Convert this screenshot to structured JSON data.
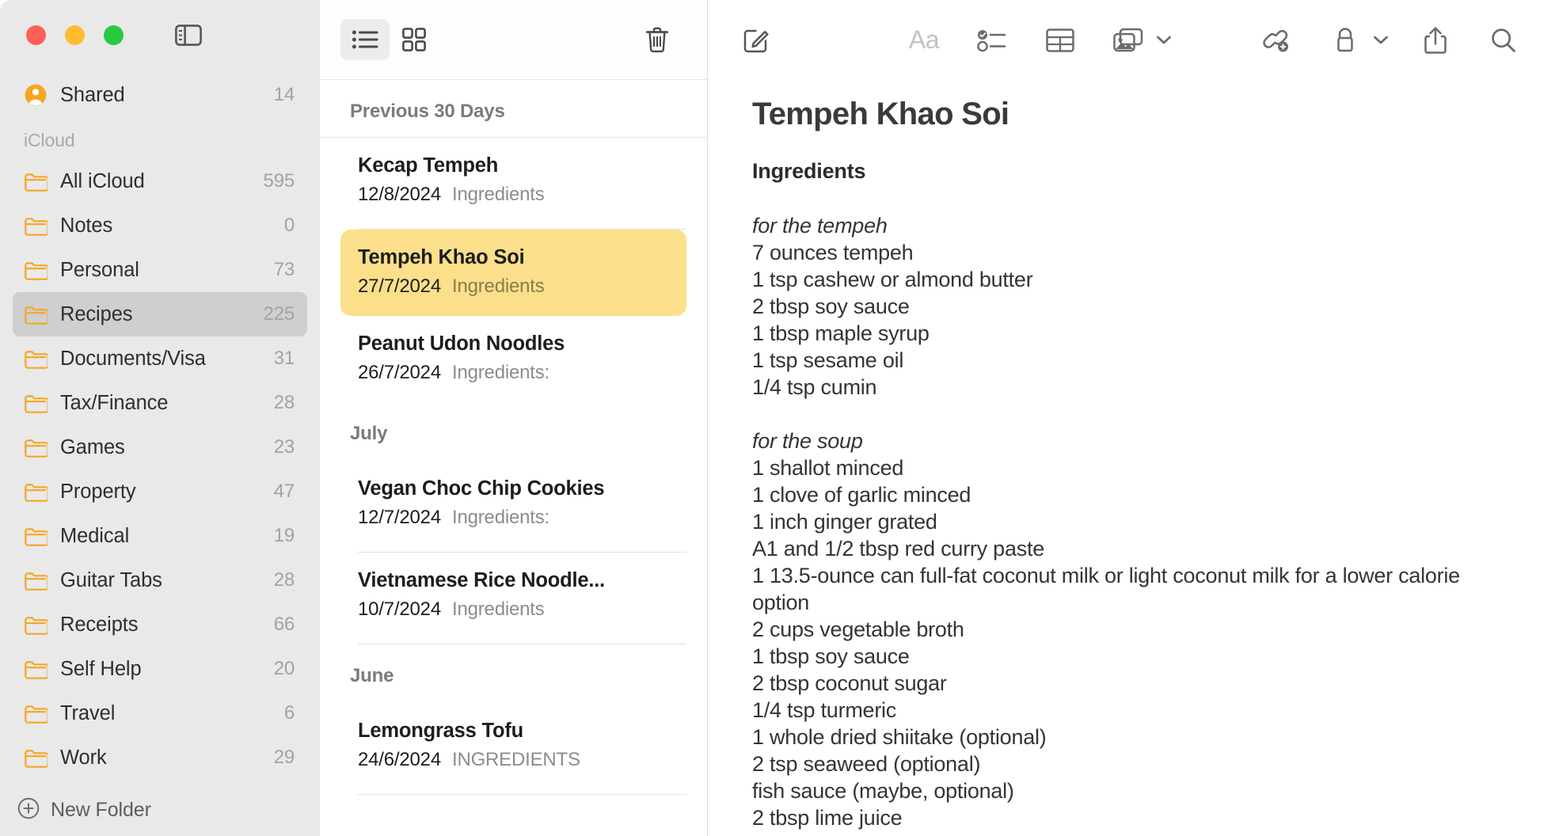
{
  "window": {
    "traffic_lights": {
      "close_color": "#ff5f57",
      "minimize_color": "#febc2e",
      "zoom_color": "#28c840"
    }
  },
  "sidebar": {
    "toggle_icon": "sidebar-toggle-icon",
    "shared": {
      "label": "Shared",
      "count": "14",
      "icon": "shared-person-icon"
    },
    "section_label": "iCloud",
    "folder_icon_color": "#f5a623",
    "folders": [
      {
        "label": "All iCloud",
        "count": "595",
        "selected": false
      },
      {
        "label": "Notes",
        "count": "0",
        "selected": false
      },
      {
        "label": "Personal",
        "count": "73",
        "selected": false
      },
      {
        "label": "Recipes",
        "count": "225",
        "selected": true
      },
      {
        "label": "Documents/Visa",
        "count": "31",
        "selected": false
      },
      {
        "label": "Tax/Finance",
        "count": "28",
        "selected": false
      },
      {
        "label": "Games",
        "count": "23",
        "selected": false
      },
      {
        "label": "Property",
        "count": "47",
        "selected": false
      },
      {
        "label": "Medical",
        "count": "19",
        "selected": false
      },
      {
        "label": "Guitar Tabs",
        "count": "28",
        "selected": false
      },
      {
        "label": "Receipts",
        "count": "66",
        "selected": false
      },
      {
        "label": "Self Help",
        "count": "20",
        "selected": false
      },
      {
        "label": "Travel",
        "count": "6",
        "selected": false
      },
      {
        "label": "Work",
        "count": "29",
        "selected": false
      }
    ],
    "new_folder_label": "New Folder",
    "new_folder_icon": "plus-circle-icon"
  },
  "list_toolbar": {
    "list_view_icon": "list-view-icon",
    "gallery_view_icon": "gallery-view-icon",
    "delete_icon": "trash-icon",
    "active_view": "list"
  },
  "notes_list": {
    "selected_note_color": "#fbdf8a",
    "groups": [
      {
        "header": "Previous 30 Days",
        "notes": [
          {
            "title": "Kecap Tempeh",
            "date": "12/8/2024",
            "preview": "Ingredients",
            "selected": false
          },
          {
            "title": "Tempeh Khao Soi",
            "date": "27/7/2024",
            "preview": "Ingredients",
            "selected": true
          },
          {
            "title": "Peanut Udon Noodles",
            "date": "26/7/2024",
            "preview": "Ingredients:",
            "selected": false
          }
        ]
      },
      {
        "header": "July",
        "notes": [
          {
            "title": "Vegan Choc Chip Cookies",
            "date": "12/7/2024",
            "preview": "Ingredients:",
            "selected": false
          },
          {
            "title": "Vietnamese Rice Noodle...",
            "date": "10/7/2024",
            "preview": "Ingredients",
            "selected": false
          }
        ]
      },
      {
        "header": "June",
        "notes": [
          {
            "title": "Lemongrass Tofu",
            "date": "24/6/2024",
            "preview": "INGREDIENTS",
            "selected": false
          }
        ]
      }
    ]
  },
  "editor_toolbar": {
    "compose_icon": "compose-note-icon",
    "format_label": "Aa",
    "format_icon": "text-format-icon",
    "checklist_icon": "checklist-icon",
    "table_icon": "table-icon",
    "media_icon": "media-insert-icon",
    "media_chevron_icon": "chevron-down-icon",
    "link_icon": "add-link-icon",
    "lock_icon": "lock-icon",
    "lock_chevron_icon": "chevron-down-icon",
    "share_icon": "share-icon",
    "search_icon": "search-icon"
  },
  "note": {
    "title": "Tempeh Khao Soi",
    "heading": "Ingredients",
    "sections": [
      {
        "label": "for the tempeh",
        "items": [
          "7 ounces tempeh",
          "1 tsp cashew or almond butter",
          "2 tbsp soy sauce",
          "1 tbsp maple syrup",
          "1 tsp sesame oil",
          "1/4 tsp cumin"
        ]
      },
      {
        "label": "for the soup",
        "items": [
          "1 shallot minced",
          "1 clove of garlic minced",
          "1 inch ginger grated",
          "A1 and 1/2 tbsp red curry paste",
          "1 13.5-ounce can full-fat coconut milk or light coconut milk for a lower calorie option",
          "2 cups vegetable broth",
          "1 tbsp soy sauce",
          "2 tbsp coconut sugar",
          "1/4 tsp turmeric",
          "1 whole dried shiitake (optional)",
          "2 tsp seaweed (optional)",
          "fish sauce (maybe, optional)",
          "2 tbsp lime juice"
        ]
      }
    ]
  }
}
